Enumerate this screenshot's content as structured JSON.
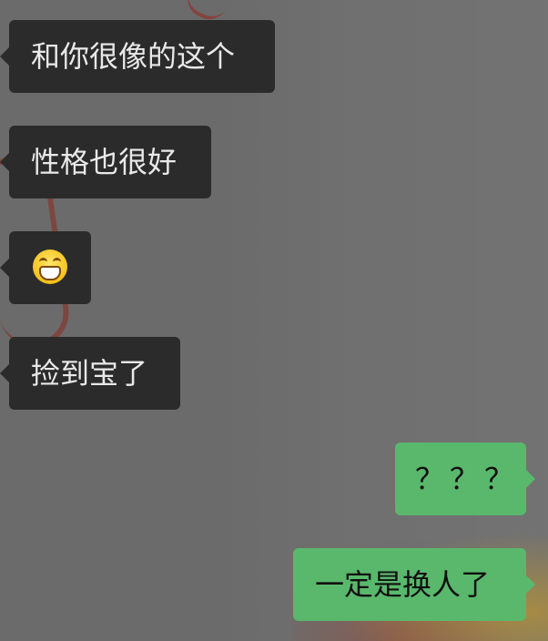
{
  "messages": [
    {
      "side": "left",
      "text": "和你很像的这个"
    },
    {
      "side": "left",
      "text": "性格也很好"
    },
    {
      "side": "left",
      "text": "",
      "emoji": "grinning-face-emoji"
    },
    {
      "side": "left",
      "text": "捡到宝了"
    },
    {
      "side": "right",
      "text": "？？？"
    },
    {
      "side": "right",
      "text": "一定是换人了"
    }
  ],
  "colors": {
    "background": "#6b6b6b",
    "incoming_bubble": "#2b2b2b",
    "outgoing_bubble": "#5ab86c"
  }
}
